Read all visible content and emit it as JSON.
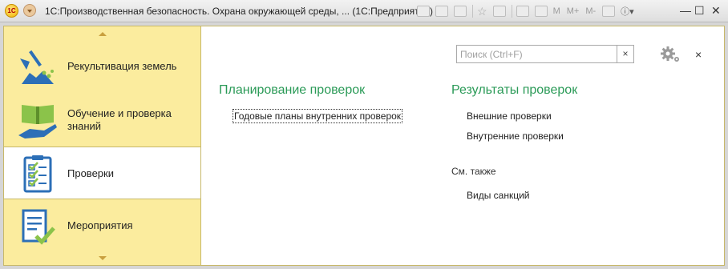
{
  "window": {
    "logo": "1С",
    "title": "1С:Производственная безопасность. Охрана окружающей среды, ...  (1С:Предприятие)",
    "toolbar": {
      "m": "M",
      "mplus": "M+",
      "mminus": "M-"
    },
    "controls": {
      "minimize": "—",
      "maximize": "☐",
      "close": "✕"
    }
  },
  "sections": [
    {
      "label": "Рекультивация земель",
      "icon": "land-reclamation-icon",
      "active": false
    },
    {
      "label_line1": "Обучение и проверка",
      "label_line2": "знаний",
      "icon": "training-book-icon",
      "active": false
    },
    {
      "label": "Проверки",
      "icon": "checklist-clipboard-icon",
      "active": true
    },
    {
      "label": "Мероприятия",
      "icon": "document-check-icon",
      "active": false
    }
  ],
  "search": {
    "placeholder": "Поиск (Ctrl+F)",
    "value": "",
    "clear": "×"
  },
  "close_form": "×",
  "groups": {
    "planning": {
      "title": "Планирование проверок",
      "links": [
        "Годовые планы внутренних проверок"
      ]
    },
    "results": {
      "title": "Результаты проверок",
      "links": [
        "Внешние проверки",
        "Внутренние проверки"
      ]
    },
    "see_also": {
      "title": "См. также",
      "links": [
        "Виды санкций"
      ]
    }
  },
  "colors": {
    "accent_green": "#2a9a57",
    "section_bg": "#fbec9e"
  }
}
